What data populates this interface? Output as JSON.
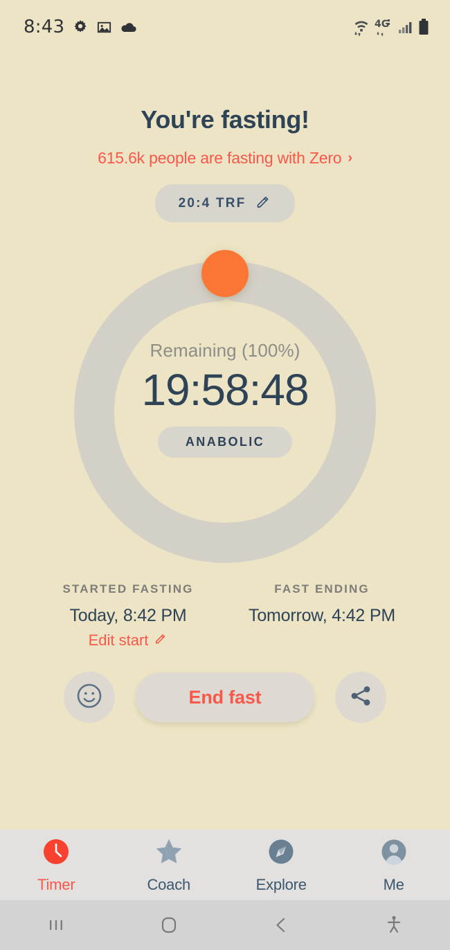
{
  "status_bar": {
    "time": "8:43",
    "left_icons": [
      "gear-icon",
      "image-icon",
      "cloud-icon"
    ],
    "right_icons": [
      "wifi-icon",
      "4g-icon",
      "signal-icon",
      "battery-icon"
    ],
    "network_label": "4G"
  },
  "header": {
    "title": "You're fasting!",
    "social_text": "615.6k people are fasting with Zero",
    "social_chevron": "›",
    "protocol_label": "20:4 TRF",
    "protocol_edit_icon": "pencil-icon"
  },
  "timer": {
    "remaining_label": "Remaining (100%)",
    "value": "19:58:48",
    "stage_badge": "ANABOLIC",
    "progress_percent": 100,
    "ring_color": "#d3d0c8",
    "knob_color": "#fb7434"
  },
  "fast_times": {
    "start": {
      "heading": "STARTED FASTING",
      "value": "Today, 8:42 PM",
      "edit_label": "Edit start",
      "edit_icon": "pencil-icon"
    },
    "end": {
      "heading": "FAST ENDING",
      "value": "Tomorrow, 4:42 PM"
    }
  },
  "actions": {
    "mood_icon": "smiley-face-icon",
    "end_fast_label": "End fast",
    "share_icon": "share-icon"
  },
  "bottom_nav": {
    "items": [
      {
        "label": "Timer",
        "icon": "timer-icon",
        "active": true
      },
      {
        "label": "Coach",
        "icon": "star-icon",
        "active": false
      },
      {
        "label": "Explore",
        "icon": "compass-icon",
        "active": false
      },
      {
        "label": "Me",
        "icon": "avatar-icon",
        "active": false
      }
    ]
  },
  "android_nav": {
    "recents_icon": "recents-icon",
    "home_icon": "home-icon",
    "back_icon": "back-icon",
    "accessibility_icon": "accessibility-icon"
  },
  "colors": {
    "background": "#ece4c4",
    "accent": "#f8584a",
    "navy": "#2e4356",
    "orange": "#fb7434"
  }
}
